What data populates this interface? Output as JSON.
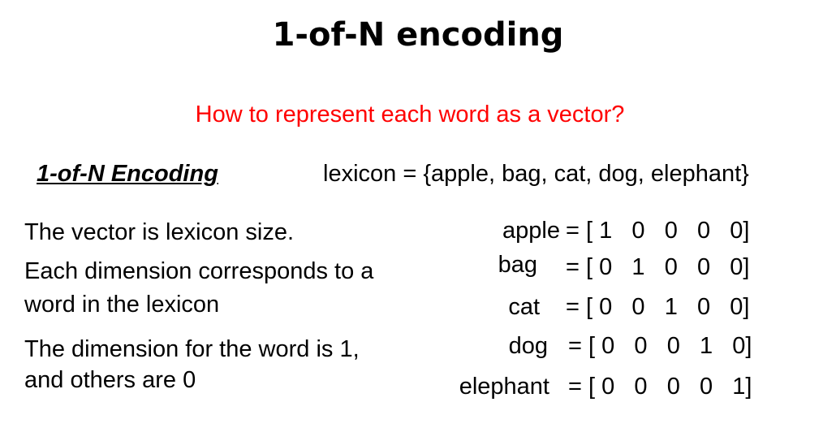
{
  "title": "1-of-N encoding",
  "subtitle": "How to represent each word as a vector?",
  "encoding_heading": "1-of-N Encoding",
  "lexicon": "lexicon = {apple, bag, cat, dog, elephant}",
  "left_text": [
    "The vector is lexicon size.",
    "Each dimension corresponds to a",
    "word in the lexicon",
    "The dimension for the word is 1,",
    "and others are 0"
  ],
  "vectors": [
    {
      "word": "apple",
      "vector": "= [ 1   0   0   0   0]"
    },
    {
      "word": "bag",
      "vector": "= [ 0   1   0   0   0]"
    },
    {
      "word": "cat",
      "vector": "= [ 0   0   1   0   0]"
    },
    {
      "word": "dog",
      "vector": "= [ 0   0   0   1   0]"
    },
    {
      "word": "elephant",
      "vector": "= [ 0   0   0   0   1]"
    }
  ]
}
